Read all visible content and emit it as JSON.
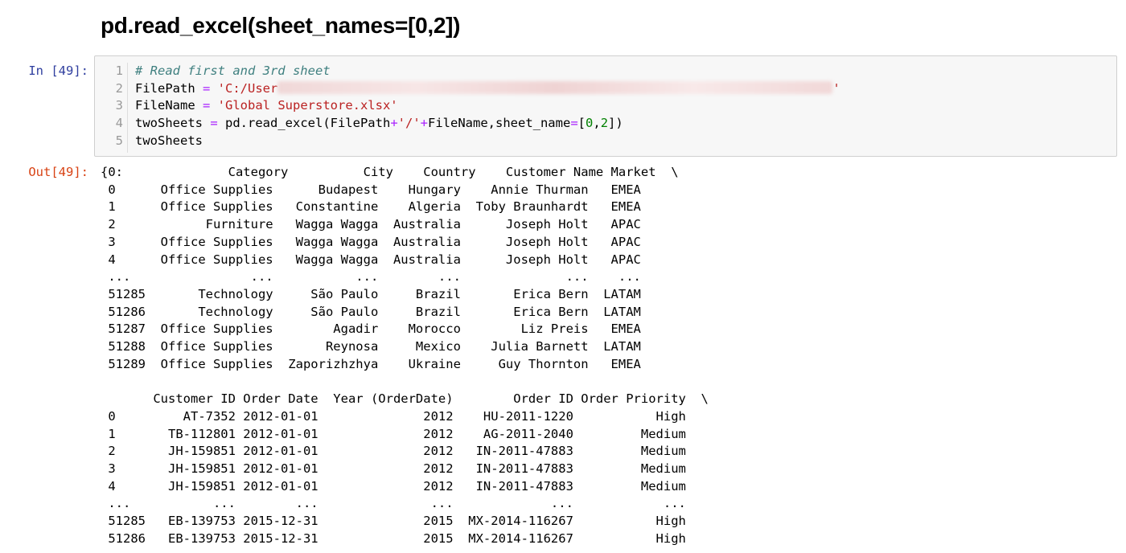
{
  "heading": "pd.read_excel(sheet_names=[0,2])",
  "cell": {
    "in_prompt": "In [49]:",
    "out_prompt": "Out[49]:",
    "line_numbers": [
      "1",
      "2",
      "3",
      "4",
      "5"
    ],
    "code": {
      "line1_comment": "# Read first and 3rd sheet",
      "line2_var": "FilePath ",
      "line2_eq": "=",
      "line2_str_start": " 'C:/User",
      "line2_str_end": "'",
      "line3_var": "FileName ",
      "line3_eq": "=",
      "line3_str": " 'Global Superstore.xlsx'",
      "line4_a": "twoSheets ",
      "line4_eq": "=",
      "line4_b": " pd.read_excel(FilePath",
      "line4_plus1": "+",
      "line4_str": "'/'",
      "line4_plus2": "+",
      "line4_c": "FileName,sheet_name",
      "line4_eq2": "=",
      "line4_d": "[",
      "line4_n0": "0",
      "line4_e": ",",
      "line4_n2": "2",
      "line4_f": "])",
      "line5": "twoSheets"
    },
    "output_lines": [
      "{0:              Category          City    Country    Customer Name Market  \\",
      " 0      Office Supplies      Budapest    Hungary    Annie Thurman   EMEA",
      " 1      Office Supplies   Constantine    Algeria  Toby Braunhardt   EMEA",
      " 2            Furniture   Wagga Wagga  Australia      Joseph Holt   APAC",
      " 3      Office Supplies   Wagga Wagga  Australia      Joseph Holt   APAC",
      " 4      Office Supplies   Wagga Wagga  Australia      Joseph Holt   APAC",
      " ...                ...           ...        ...              ...    ...",
      " 51285       Technology     São Paulo     Brazil       Erica Bern  LATAM",
      " 51286       Technology     São Paulo     Brazil       Erica Bern  LATAM",
      " 51287  Office Supplies        Agadir    Morocco        Liz Preis   EMEA",
      " 51288  Office Supplies       Reynosa     Mexico    Julia Barnett  LATAM",
      " 51289  Office Supplies  Zaporizhzhya    Ukraine     Guy Thornton   EMEA",
      "",
      "       Customer ID Order Date  Year (OrderDate)        Order ID Order Priority  \\",
      " 0         AT-7352 2012-01-01              2012    HU-2011-1220           High",
      " 1       TB-112801 2012-01-01              2012    AG-2011-2040         Medium",
      " 2       JH-159851 2012-01-01              2012   IN-2011-47883         Medium",
      " 3       JH-159851 2012-01-01              2012   IN-2011-47883         Medium",
      " 4       JH-159851 2012-01-01              2012   IN-2011-47883         Medium",
      " ...           ...        ...               ...             ...            ...",
      " 51285   EB-139753 2015-12-31              2015  MX-2014-116267           High",
      " 51286   EB-139753 2015-12-31              2015  MX-2014-116267           High"
    ]
  }
}
